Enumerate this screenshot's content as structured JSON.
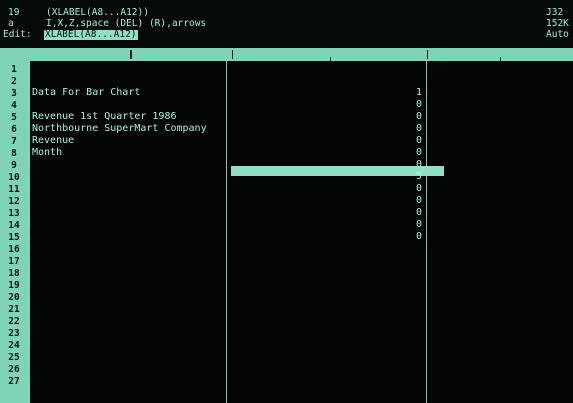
{
  "status": {
    "cell_address": "19",
    "mode_a": "a",
    "mode_edit": "Edit:",
    "cell_contents": "(XLABEL(A8...A12))",
    "help_keys": "I,X,Z,space (DEL) (R),arrows",
    "edit_line": "XLABEL(A8...A12)",
    "right_1": "J32",
    "right_2": "152K",
    "right_3": "Auto"
  },
  "row_numbers": [
    "1",
    "2",
    "3",
    "4",
    "5",
    "6",
    "7",
    "8",
    "9",
    "10",
    "11",
    "12",
    "13",
    "14",
    "15",
    "16",
    "17",
    "18",
    "19",
    "20",
    "21",
    "22",
    "23",
    "24",
    "25",
    "26",
    "27"
  ],
  "cells": {
    "A3": "Data For Bar Chart",
    "A5": "Revenue 1st Quarter 1986",
    "A6": "Northbourne SuperMart Company",
    "A7": "Revenue",
    "A8": "Month",
    "values": [
      "1",
      "0",
      "0",
      "0",
      "0",
      "0",
      "0",
      "5",
      "0",
      "0",
      "0",
      "0",
      "0"
    ]
  },
  "colors": {
    "screen": "#030605",
    "phosphor": "#8fe0c4",
    "text": "#a7f2d6"
  }
}
